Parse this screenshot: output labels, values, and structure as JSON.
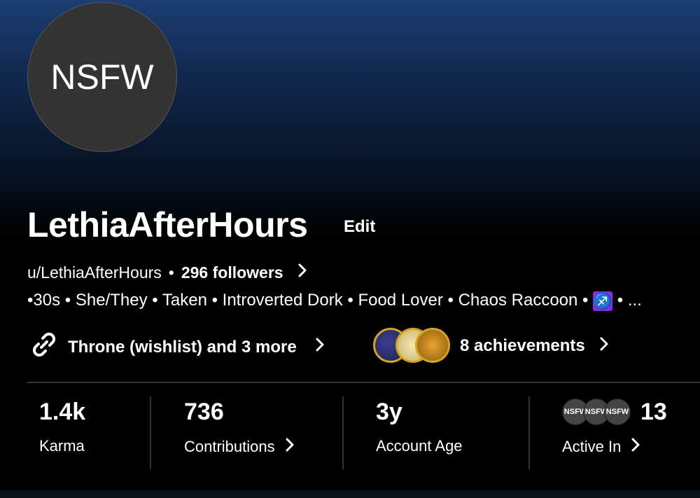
{
  "profile": {
    "avatar_text": "NSFW",
    "display_name": "LethiaAfterHours",
    "edit_label": "Edit",
    "username": "u/LethiaAfterHours",
    "separator": "•",
    "followers": "296 followers",
    "bio_text": "•30s • She/They • Taken • Introverted Dork • Food Lover • Chaos Raccoon • ",
    "bio_emoji": "♐",
    "bio_tail": " • ..."
  },
  "links": {
    "label": "Throne (wishlist) and 3 more"
  },
  "achievements": {
    "label": "8 achievements"
  },
  "stats": {
    "karma": {
      "value": "1.4k",
      "label": "Karma"
    },
    "contributions": {
      "value": "736",
      "label": "Contributions"
    },
    "account_age": {
      "value": "3y",
      "label": "Account Age"
    },
    "active_in": {
      "value": "13",
      "label": "Active In",
      "avatars": [
        "NSFW",
        "NSFW",
        "NSFW"
      ]
    }
  },
  "colors": {
    "header_top": "#1c3e73",
    "background": "#000000",
    "divider": "#333333",
    "badge_border": "#d4a41c"
  }
}
